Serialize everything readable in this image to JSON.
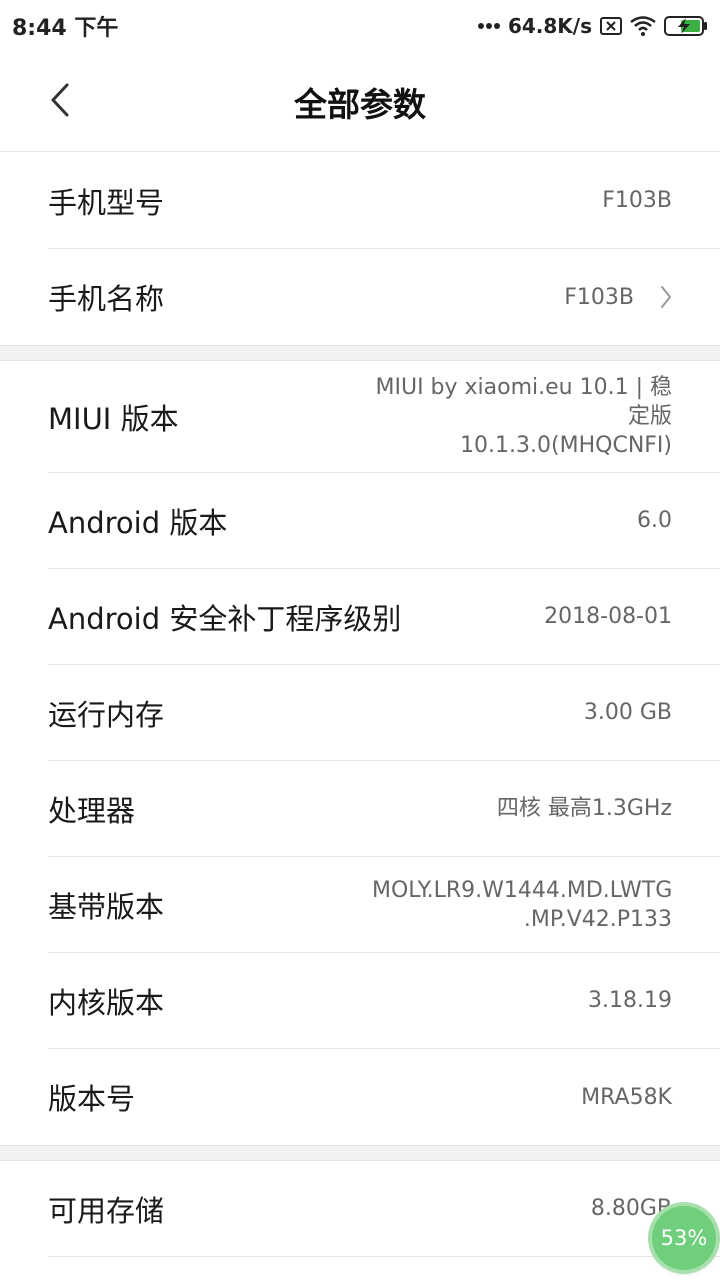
{
  "status_bar": {
    "time": "8:44 下午",
    "network_speed": "64.8K/s",
    "icons": [
      "more-dots-icon",
      "sim-off-icon",
      "wifi-icon",
      "battery-charging-icon"
    ]
  },
  "header": {
    "title": "全部参数",
    "back_icon": "chevron-left-icon"
  },
  "section1": [
    {
      "label": "手机型号",
      "value": "F103B"
    },
    {
      "label": "手机名称",
      "value": "F103B",
      "chevron": true
    }
  ],
  "section2": [
    {
      "label": "MIUI 版本",
      "value": "MIUI by xiaomi.eu 10.1 | 稳\n定版\n10.1.3.0(MHQCNFI)"
    },
    {
      "label": "Android 版本",
      "value": "6.0"
    },
    {
      "label": "Android 安全补丁程序级别",
      "value": "2018-08-01"
    },
    {
      "label": "运行内存",
      "value": "3.00 GB"
    },
    {
      "label": "处理器",
      "value": "四核 最高1.3GHz"
    },
    {
      "label": "基带版本",
      "value": "MOLY.LR9.W1444.MD.LWTG\n.MP.V42.P133"
    },
    {
      "label": "内核版本",
      "value": "3.18.19"
    },
    {
      "label": "版本号",
      "value": "MRA58K"
    }
  ],
  "section3": [
    {
      "label": "可用存储",
      "value": "8.80GB"
    }
  ],
  "overlay_badge": {
    "text": "53%"
  },
  "colors": {
    "background": "#ffffff",
    "divider": "#e6e6e6",
    "value_text": "#666666",
    "badge": "#6fcf7d"
  }
}
